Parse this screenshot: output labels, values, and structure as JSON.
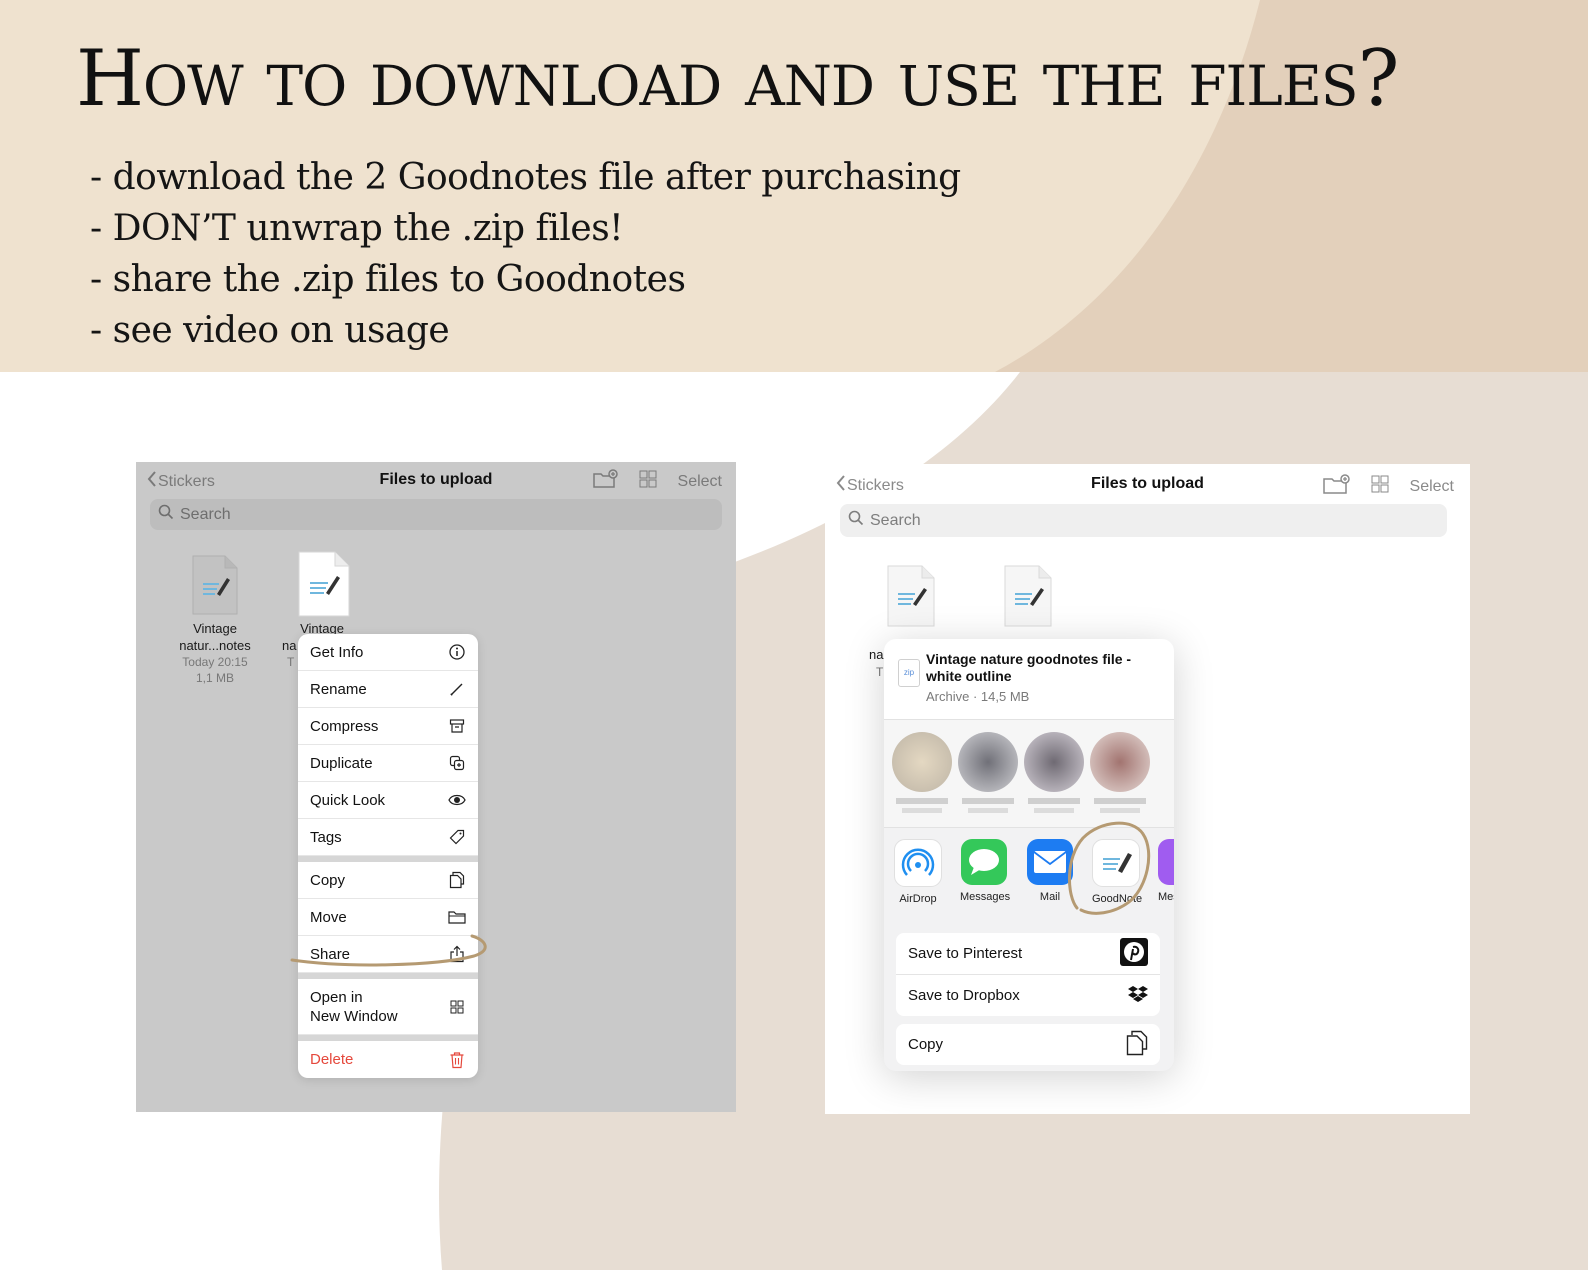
{
  "heading": "How to download and use the files?",
  "steps": [
    "- download the 2 Goodnotes file after purchasing",
    "- DON’T unwrap the .zip files!",
    "- share the .zip files to Goodnotes",
    "- see video on usage"
  ],
  "colors": {
    "top_band": "#efe2cf",
    "beige_shape": "#e7ddd3",
    "panel_grey": "#c9c9c9",
    "circle_annotation": "#b59a72",
    "danger": "#e5483c"
  },
  "left_screen": {
    "nav": {
      "back_label": "Stickers",
      "title": "Files to upload",
      "select_label": "Select",
      "icons": [
        "chevron-left-icon",
        "new-folder-icon",
        "grid-view-icon"
      ]
    },
    "search_placeholder": "Search",
    "files": [
      {
        "name_line1": "Vintage",
        "name_line2": "natur...notes",
        "date": "Today 20:15",
        "size": "1,1 MB"
      },
      {
        "name_line1": "Vintage",
        "name_line2": "na",
        "date": "T"
      }
    ],
    "context_menu": [
      {
        "label": "Get Info",
        "icon": "info-icon"
      },
      {
        "label": "Rename",
        "icon": "pencil-icon"
      },
      {
        "label": "Compress",
        "icon": "archive-box-icon"
      },
      {
        "label": "Duplicate",
        "icon": "duplicate-icon"
      },
      {
        "label": "Quick Look",
        "icon": "eye-icon"
      },
      {
        "label": "Tags",
        "icon": "tag-icon"
      },
      {
        "label": "Copy",
        "icon": "copy-icon"
      },
      {
        "label": "Move",
        "icon": "folder-icon"
      },
      {
        "label": "Share",
        "icon": "share-icon"
      },
      {
        "label": "Open in",
        "label_line2": "New Window",
        "icon": "grid-icon"
      },
      {
        "label": "Delete",
        "icon": "trash-icon"
      }
    ]
  },
  "right_screen": {
    "nav": {
      "back_label": "Stickers",
      "title": "Files to upload",
      "select_label": "Select"
    },
    "search_placeholder": "Search",
    "file_fragments": [
      "na",
      "T"
    ],
    "share_sheet": {
      "badge": "zip",
      "title": "Vintage nature goodnotes file - white outline",
      "meta": "Archive · 14,5 MB",
      "apps": [
        {
          "label": "AirDrop",
          "icon": "airdrop-icon"
        },
        {
          "label": "Messages",
          "icon": "messages-icon"
        },
        {
          "label": "Mail",
          "icon": "mail-icon"
        },
        {
          "label": "GoodNote",
          "icon": "goodnotes-icon"
        },
        {
          "label": "Mes",
          "icon": "messenger-icon"
        }
      ],
      "actions": [
        {
          "label": "Save to Pinterest",
          "icon": "pinterest-icon"
        },
        {
          "label": "Save to Dropbox",
          "icon": "dropbox-icon"
        },
        {
          "label": "Copy",
          "icon": "copy-icon"
        }
      ]
    }
  }
}
